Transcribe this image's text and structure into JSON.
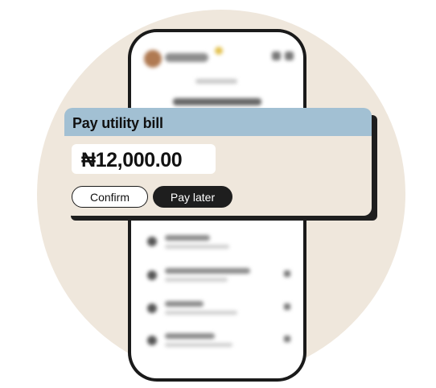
{
  "card": {
    "title": "Pay utility bill",
    "amount": "₦12,000.00",
    "confirm_label": "Confirm",
    "pay_later_label": "Pay later"
  },
  "colors": {
    "backdrop_circle": "#efe7dc",
    "card_header": "#a2c0d3",
    "card_body": "#efe7dc",
    "primary_button": "#1e1e1e",
    "phone_frame": "#1a1a1a"
  },
  "phone": {
    "icons": [
      "avatar",
      "sparkle-icon",
      "notification-icon",
      "menu-icon",
      "nav-home-icon",
      "nav-icon",
      "nav-icon",
      "nav-icon",
      "nav-icon"
    ]
  }
}
